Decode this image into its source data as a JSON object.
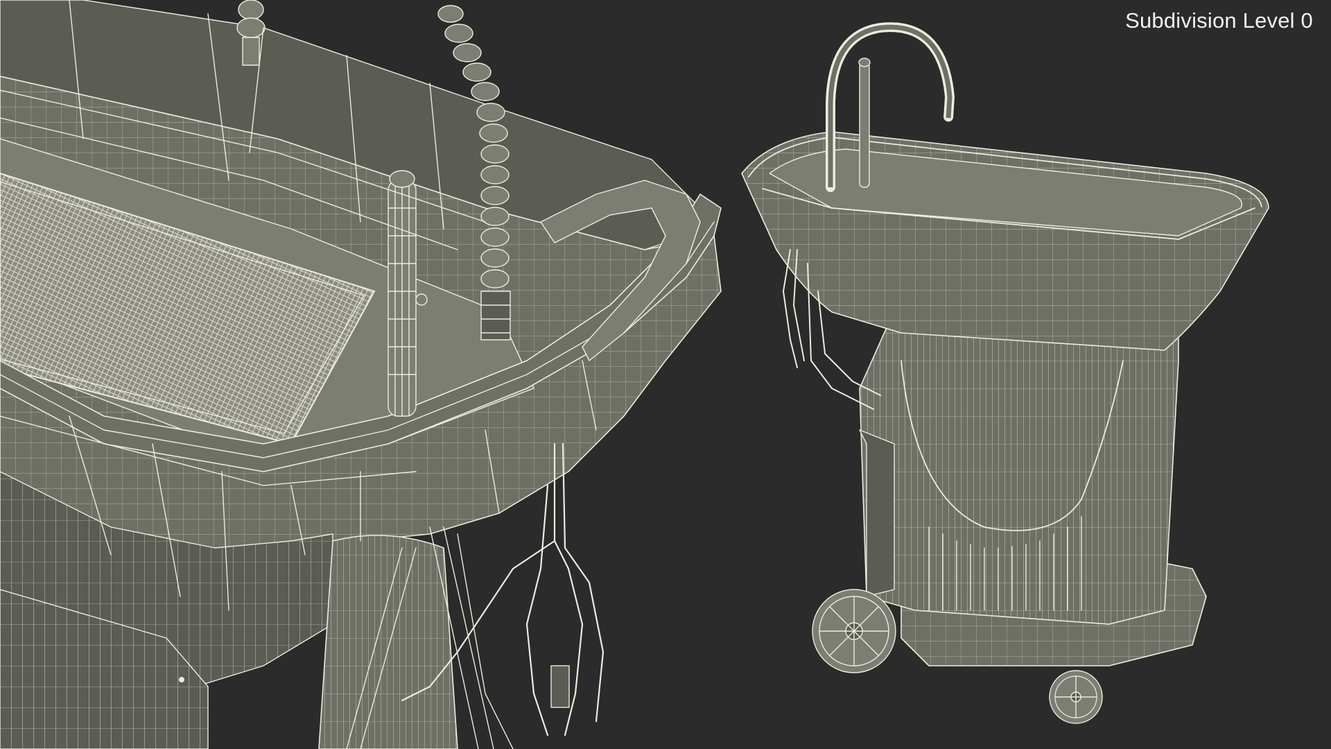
{
  "viewport": {
    "label": "Subdivision Level 0",
    "background": "#2b2b2b",
    "model_color": "#6f7065",
    "wire_color": "#ececdf"
  },
  "views": [
    {
      "name": "closeup-view"
    },
    {
      "name": "full-view"
    }
  ]
}
